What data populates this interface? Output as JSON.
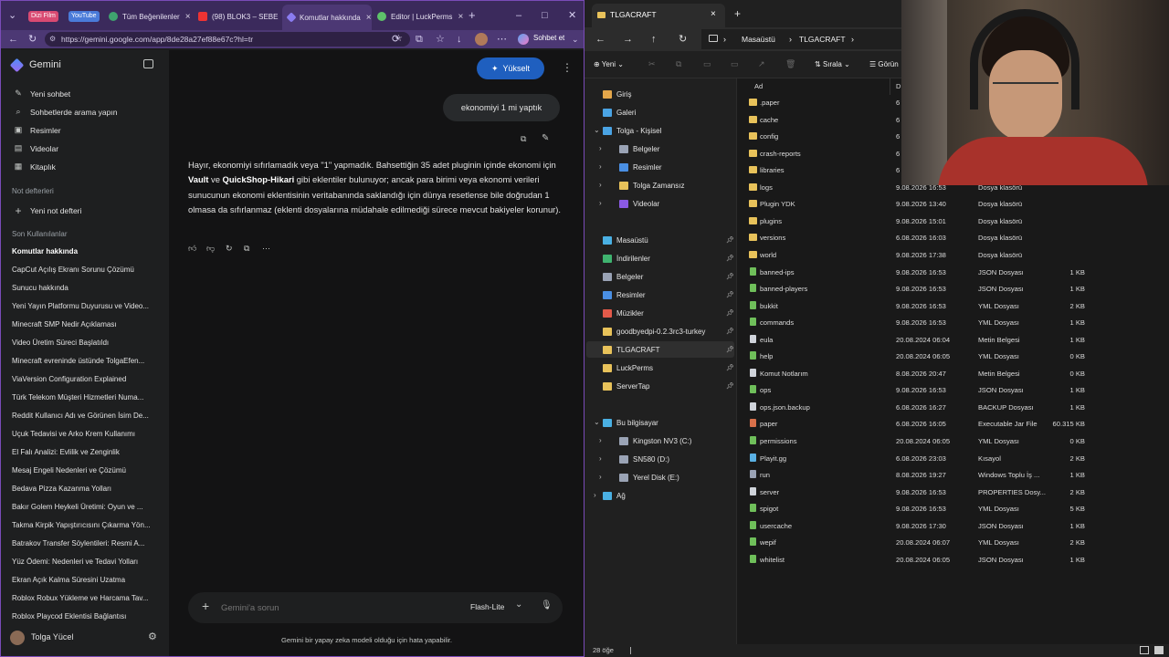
{
  "browser": {
    "tabs": [
      {
        "label": "Dizi Film",
        "pill": true,
        "color": "#d94a72"
      },
      {
        "label": "YouTube",
        "pill": true,
        "color": "#4a7bd9"
      },
      {
        "label": "Tüm Beğenilenler"
      },
      {
        "label": "(98) BLOK3 – SEBE"
      },
      {
        "label": "Komutlar hakkında",
        "active": true
      },
      {
        "label": "Editor | LuckPerms"
      }
    ],
    "url": "https://gemini.google.com/app/8de28a27ef88e67c?hl=tr",
    "profile_label": "Sohbet et"
  },
  "gemini": {
    "brand": "Gemini",
    "upgrade_label": "Yükselt",
    "nav": [
      {
        "label": "Yeni sohbet",
        "icon": "edit-icon"
      },
      {
        "label": "Sohbetlerde arama yapın",
        "icon": "search-icon"
      },
      {
        "label": "Resimler",
        "icon": "image-icon"
      },
      {
        "label": "Videolar",
        "icon": "video-icon"
      },
      {
        "label": "Kitaplık",
        "icon": "library-icon"
      }
    ],
    "notebooks_header": "Not defterleri",
    "new_notebook": "Yeni not defteri",
    "recent_header": "Son Kullanılanlar",
    "recents": [
      "Komutlar hakkında",
      "CapCut Açılış Ekranı Sorunu Çözümü",
      "Sunucu hakkında",
      "Yeni Yayın Platformu Duyurusu ve Video...",
      "Minecraft SMP Nedir Açıklaması",
      "Video Üretim Süreci Başlatıldı",
      "Minecraft evreninde üstünde TolgaEfen...",
      "ViaVersion Configuration Explained",
      "Türk Telekom Müşteri Hizmetleri Numa...",
      "Reddit Kullanıcı Adı ve Görünen İsim De...",
      "Uçuk Tedavisi ve Arko Krem Kullanımı",
      "El Falı Analizi: Evlilik ve Zenginlik",
      "Mesaj Engeli Nedenleri ve Çözümü",
      "Bedava Pizza Kazanma Yolları",
      "Bakır Golem Heykeli Üretimi: Oyun ve ...",
      "Takma Kirpik Yapıştırıcısını Çıkarma Yön...",
      "Batrakov Transfer Söylentileri: Resmi A...",
      "Yüz Ödemi: Nedenleri ve Tedavi Yolları",
      "Ekran Açık Kalma Süresini Uzatma",
      "Roblox Robux Yükleme ve Harcama Tav...",
      "Roblox Playcod Eklentisi Bağlantısı"
    ],
    "user_name": "Tolga Yücel",
    "user_message": "ekonomiyi 1 mi yaptık",
    "response_parts": [
      "Hayır, ekonomiyi sıfırlamadık veya \"1\" yapmadık. Bahsettiğin 35 adet pluginin içinde ekonomi için ",
      "Vault",
      " ve ",
      "QuickShop-Hikari",
      " gibi eklentiler bulunuyor; ancak para birimi veya ekonomi verileri sunucunun ekonomi eklentisinin veritabanında saklandığı için dünya resetlense bile doğrudan 1 olmasa da sıfırlanmaz (eklenti dosyalarına müdahale edilmediği sürece mevcut bakiyeler korunur)."
    ],
    "input_placeholder": "Gemini'a sorun",
    "model_label": "Flash-Lite",
    "disclaimer": "Gemini bir yapay zeka modeli olduğu için hata yapabilir."
  },
  "explorer": {
    "tab_title": "TLGACRAFT",
    "breadcrumb": [
      "Masaüstü",
      "TLGACRAFT"
    ],
    "toolbar": {
      "new_label": "Yeni",
      "sort_label": "Sırala",
      "view_label": "Görün"
    },
    "column_name": "Ad",
    "column_date": "D",
    "nav_pane": [
      {
        "label": "Giriş",
        "icon": "home-icon",
        "color": "#e3a64a"
      },
      {
        "label": "Galeri",
        "icon": "gallery-icon",
        "color": "#4aa3e3"
      },
      {
        "label": "Tolga - Kişisel",
        "icon": "cloud-icon",
        "color": "#4aa3e3",
        "expanded": true
      },
      {
        "label": "Belgeler",
        "icon": "documents-icon",
        "color": "#9aa3b5",
        "indent": true
      },
      {
        "label": "Resimler",
        "icon": "pictures-icon",
        "color": "#4a8fe3",
        "indent": true
      },
      {
        "label": "Tolga Zamansız",
        "icon": "folder-icon",
        "color": "#e8c25a",
        "indent": true
      },
      {
        "label": "Videolar",
        "icon": "videos-icon",
        "color": "#8a5ae3",
        "indent": true
      },
      {
        "label": "Masaüstü",
        "icon": "desktop-icon",
        "color": "#4ab0e3",
        "pinned": true
      },
      {
        "label": "İndirilenler",
        "icon": "downloads-icon",
        "color": "#3fb36f",
        "pinned": true
      },
      {
        "label": "Belgeler",
        "icon": "documents-icon",
        "color": "#9aa3b5",
        "pinned": true
      },
      {
        "label": "Resimler",
        "icon": "pictures-icon",
        "color": "#4a8fe3",
        "pinned": true
      },
      {
        "label": "Müzikler",
        "icon": "music-icon",
        "color": "#e35a4a",
        "pinned": true
      },
      {
        "label": "goodbyedpi-0.2.3rc3-turkey",
        "icon": "folder-icon",
        "color": "#e8c25a",
        "pinned": true
      },
      {
        "label": "TLGACRAFT",
        "icon": "folder-icon",
        "color": "#e8c25a",
        "pinned": true,
        "selected": true
      },
      {
        "label": "LuckPerms",
        "icon": "folder-icon",
        "color": "#e8c25a",
        "pinned": true
      },
      {
        "label": "ServerTap",
        "icon": "folder-icon",
        "color": "#e8c25a",
        "pinned": true
      },
      {
        "label": "Bu bilgisayar",
        "icon": "computer-icon",
        "color": "#4ab0e3",
        "expanded": true
      },
      {
        "label": "Kingston NV3 (C:)",
        "icon": "drive-icon",
        "color": "#9aa3b5",
        "indent": true
      },
      {
        "label": "SN580 (D:)",
        "icon": "drive-icon",
        "color": "#9aa3b5",
        "indent": true
      },
      {
        "label": "Yerel Disk (E:)",
        "icon": "drive-icon",
        "color": "#9aa3b5",
        "indent": true
      },
      {
        "label": "Ağ",
        "icon": "network-icon",
        "color": "#4ab0e3"
      }
    ],
    "files": [
      {
        "name": ".paper",
        "date": "6",
        "type": "",
        "size": "",
        "kind": "folder"
      },
      {
        "name": "cache",
        "date": "6",
        "type": "",
        "size": "",
        "kind": "folder"
      },
      {
        "name": "config",
        "date": "6",
        "type": "",
        "size": "",
        "kind": "folder"
      },
      {
        "name": "crash-reports",
        "date": "6",
        "type": "",
        "size": "",
        "kind": "folder"
      },
      {
        "name": "libraries",
        "date": "6",
        "type": "",
        "size": "",
        "kind": "folder"
      },
      {
        "name": "logs",
        "date": "9.08.2026 16:53",
        "type": "Dosya klasörü",
        "size": "",
        "kind": "folder"
      },
      {
        "name": "Plugin YDK",
        "date": "9.08.2026 13:40",
        "type": "Dosya klasörü",
        "size": "",
        "kind": "folder"
      },
      {
        "name": "plugins",
        "date": "9.08.2026 15:01",
        "type": "Dosya klasörü",
        "size": "",
        "kind": "folder"
      },
      {
        "name": "versions",
        "date": "6.08.2026 16:03",
        "type": "Dosya klasörü",
        "size": "",
        "kind": "folder"
      },
      {
        "name": "world",
        "date": "9.08.2026 17:38",
        "type": "Dosya klasörü",
        "size": "",
        "kind": "folder"
      },
      {
        "name": "banned-ips",
        "date": "9.08.2026 16:53",
        "type": "JSON Dosyası",
        "size": "1 KB",
        "kind": "json"
      },
      {
        "name": "banned-players",
        "date": "9.08.2026 16:53",
        "type": "JSON Dosyası",
        "size": "1 KB",
        "kind": "json"
      },
      {
        "name": "bukkit",
        "date": "9.08.2026 16:53",
        "type": "YML Dosyası",
        "size": "2 KB",
        "kind": "yml"
      },
      {
        "name": "commands",
        "date": "9.08.2026 16:53",
        "type": "YML Dosyası",
        "size": "1 KB",
        "kind": "yml"
      },
      {
        "name": "eula",
        "date": "20.08.2024 06:04",
        "type": "Metin Belgesi",
        "size": "1 KB",
        "kind": "text"
      },
      {
        "name": "help",
        "date": "20.08.2024 06:05",
        "type": "YML Dosyası",
        "size": "0 KB",
        "kind": "yml"
      },
      {
        "name": "Komut Notlarım",
        "date": "8.08.2026 20:47",
        "type": "Metin Belgesi",
        "size": "0 KB",
        "kind": "text"
      },
      {
        "name": "ops",
        "date": "9.08.2026 16:53",
        "type": "JSON Dosyası",
        "size": "1 KB",
        "kind": "json"
      },
      {
        "name": "ops.json.backup",
        "date": "6.08.2026 16:27",
        "type": "BACKUP Dosyası",
        "size": "1 KB",
        "kind": "file"
      },
      {
        "name": "paper",
        "date": "6.08.2026 16:05",
        "type": "Executable Jar File",
        "size": "60.315 KB",
        "kind": "jar"
      },
      {
        "name": "permissions",
        "date": "20.08.2024 06:05",
        "type": "YML Dosyası",
        "size": "0 KB",
        "kind": "yml"
      },
      {
        "name": "Playit.gg",
        "date": "6.08.2026 23:03",
        "type": "Kısayol",
        "size": "2 KB",
        "kind": "shortcut"
      },
      {
        "name": "run",
        "date": "8.08.2026 19:27",
        "type": "Windows Toplu İş ...",
        "size": "1 KB",
        "kind": "bat"
      },
      {
        "name": "server",
        "date": "9.08.2026 16:53",
        "type": "PROPERTIES Dosy...",
        "size": "2 KB",
        "kind": "file"
      },
      {
        "name": "spigot",
        "date": "9.08.2026 16:53",
        "type": "YML Dosyası",
        "size": "5 KB",
        "kind": "yml"
      },
      {
        "name": "usercache",
        "date": "9.08.2026 17:30",
        "type": "JSON Dosyası",
        "size": "1 KB",
        "kind": "json"
      },
      {
        "name": "wepif",
        "date": "20.08.2024 06:07",
        "type": "YML Dosyası",
        "size": "2 KB",
        "kind": "yml"
      },
      {
        "name": "whitelist",
        "date": "20.08.2024 06:05",
        "type": "JSON Dosyası",
        "size": "1 KB",
        "kind": "json"
      }
    ],
    "status_count": "28 öğe"
  }
}
